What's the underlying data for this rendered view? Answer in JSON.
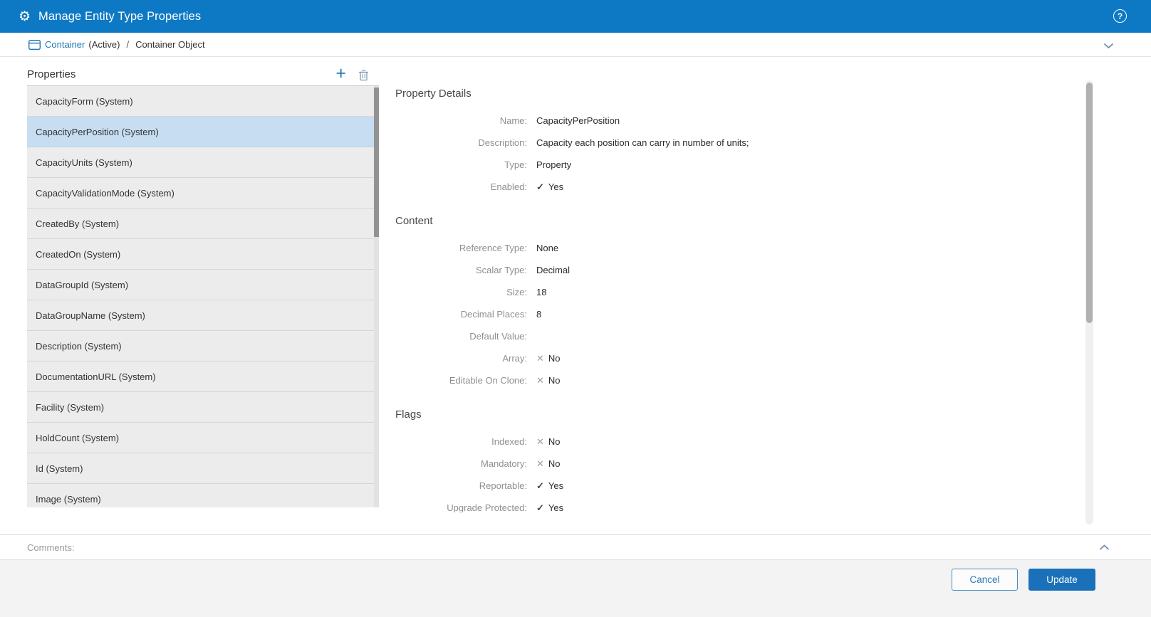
{
  "header": {
    "title": "Manage Entity Type Properties"
  },
  "breadcrumb": {
    "entity_label": "Container",
    "entity_status": "(Active)",
    "separator": "/",
    "current": "Container Object"
  },
  "properties_panel": {
    "title": "Properties",
    "items": [
      {
        "label": "CapacityForm (System)",
        "selected": false
      },
      {
        "label": "CapacityPerPosition (System)",
        "selected": true
      },
      {
        "label": "CapacityUnits (System)",
        "selected": false
      },
      {
        "label": "CapacityValidationMode (System)",
        "selected": false
      },
      {
        "label": "CreatedBy (System)",
        "selected": false
      },
      {
        "label": "CreatedOn (System)",
        "selected": false
      },
      {
        "label": "DataGroupId (System)",
        "selected": false
      },
      {
        "label": "DataGroupName (System)",
        "selected": false
      },
      {
        "label": "Description (System)",
        "selected": false
      },
      {
        "label": "DocumentationURL (System)",
        "selected": false
      },
      {
        "label": "Facility (System)",
        "selected": false
      },
      {
        "label": "HoldCount (System)",
        "selected": false
      },
      {
        "label": "Id (System)",
        "selected": false
      },
      {
        "label": "Image (System)",
        "selected": false
      }
    ]
  },
  "details": {
    "sections": [
      {
        "title": "Property Details",
        "rows": [
          {
            "label": "Name:",
            "value": "CapacityPerPosition"
          },
          {
            "label": "Description:",
            "value": "Capacity each position can carry in number of units;"
          },
          {
            "label": "Type:",
            "value": "Property"
          },
          {
            "label": "Enabled:",
            "value": "Yes",
            "icon": "check"
          }
        ]
      },
      {
        "title": "Content",
        "rows": [
          {
            "label": "Reference Type:",
            "value": "None"
          },
          {
            "label": "Scalar Type:",
            "value": "Decimal"
          },
          {
            "label": "Size:",
            "value": "18"
          },
          {
            "label": "Decimal Places:",
            "value": "8"
          },
          {
            "label": "Default Value:",
            "value": ""
          },
          {
            "label": "Array:",
            "value": "No",
            "icon": "cross"
          },
          {
            "label": "Editable On Clone:",
            "value": "No",
            "icon": "cross"
          }
        ]
      },
      {
        "title": "Flags",
        "rows": [
          {
            "label": "Indexed:",
            "value": "No",
            "icon": "cross"
          },
          {
            "label": "Mandatory:",
            "value": "No",
            "icon": "cross"
          },
          {
            "label": "Reportable:",
            "value": "Yes",
            "icon": "check"
          },
          {
            "label": "Upgrade Protected:",
            "value": "Yes",
            "icon": "check"
          }
        ]
      }
    ]
  },
  "comments": {
    "label": "Comments:"
  },
  "actions": {
    "cancel_label": "Cancel",
    "update_label": "Update"
  },
  "icons": {
    "gear": "⚙",
    "help": "?",
    "plus": "+",
    "check": "✓",
    "cross": "✕"
  },
  "colors": {
    "header_bg": "#0d79c4",
    "accent_blue": "#2277b3",
    "selected_row": "#c7def2",
    "update_button": "#1a71ba"
  }
}
